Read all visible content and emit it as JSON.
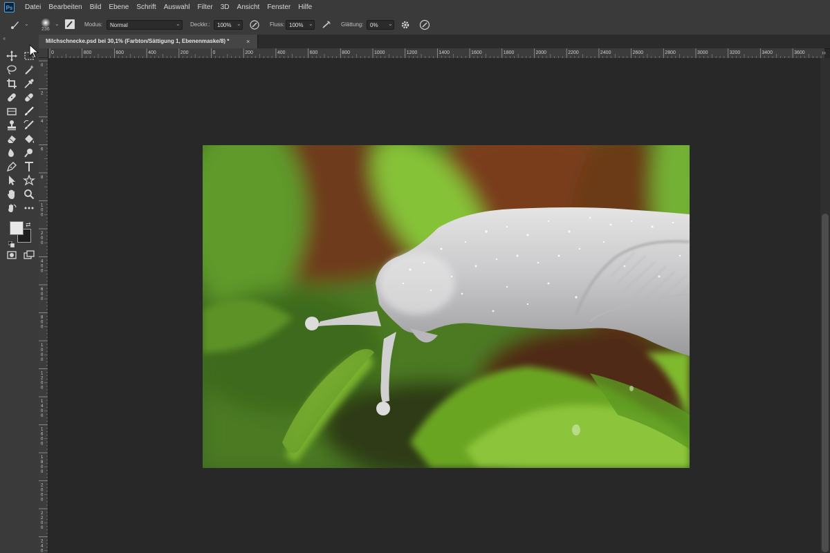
{
  "app": {
    "logo": "Ps",
    "menu": [
      "Datei",
      "Bearbeiten",
      "Bild",
      "Ebene",
      "Schrift",
      "Auswahl",
      "Filter",
      "3D",
      "Ansicht",
      "Fenster",
      "Hilfe"
    ]
  },
  "options_bar": {
    "brush_size": "236",
    "mode_label": "Modus:",
    "mode_value": "Normal",
    "opacity_label": "Deckkr.:",
    "opacity_value": "100%",
    "flow_label": "Fluss:",
    "flow_value": "100%",
    "smoothing_label": "Glättung:",
    "smoothing_value": "0%"
  },
  "document_tab": {
    "title": "Milchschnecke.psd bei 30,1% (Farbton/Sättigung 1, Ebenenmaske/8) *",
    "close": "×"
  },
  "rulers": {
    "horizontal": [
      "0",
      "800",
      "600",
      "400",
      "200",
      "0",
      "200",
      "400",
      "600",
      "800",
      "1000",
      "1200",
      "1400",
      "1600",
      "1800",
      "2000",
      "2200",
      "2400",
      "2600",
      "2800",
      "3000",
      "3200",
      "3400",
      "3600"
    ],
    "vertical": [
      "0",
      "2",
      "4",
      "6",
      "8",
      "1 0 0",
      "2 0 0",
      "4 0 0",
      "6 0 0",
      "8 0 0",
      "1 0 0 0",
      "1 2 0 0",
      "1 4 0 0",
      "1 6 0 0",
      "1 8 0 0",
      "2 0 0 0",
      "2 2 0 0",
      "2 4 0 0"
    ]
  },
  "colors": {
    "foreground": "#e8e8e8",
    "background": "#1e1e1e"
  },
  "icons": {
    "tools": [
      "move-icon",
      "marquee-icon",
      "lasso-icon",
      "magic-wand-icon",
      "crop-icon",
      "eyedropper-icon",
      "healing-brush-icon",
      "spot-healing-icon",
      "frame-icon",
      "brush-icon",
      "stamp-icon",
      "history-brush-icon",
      "eraser-icon",
      "paint-bucket-icon",
      "blur-icon",
      "dodge-icon",
      "pen-icon",
      "type-icon",
      "path-select-icon",
      "shape-icon",
      "hand-icon",
      "zoom-icon",
      "rotate-view-icon",
      "more-tools-icon",
      "quick-mask-icon",
      "screen-mode-icon"
    ]
  }
}
